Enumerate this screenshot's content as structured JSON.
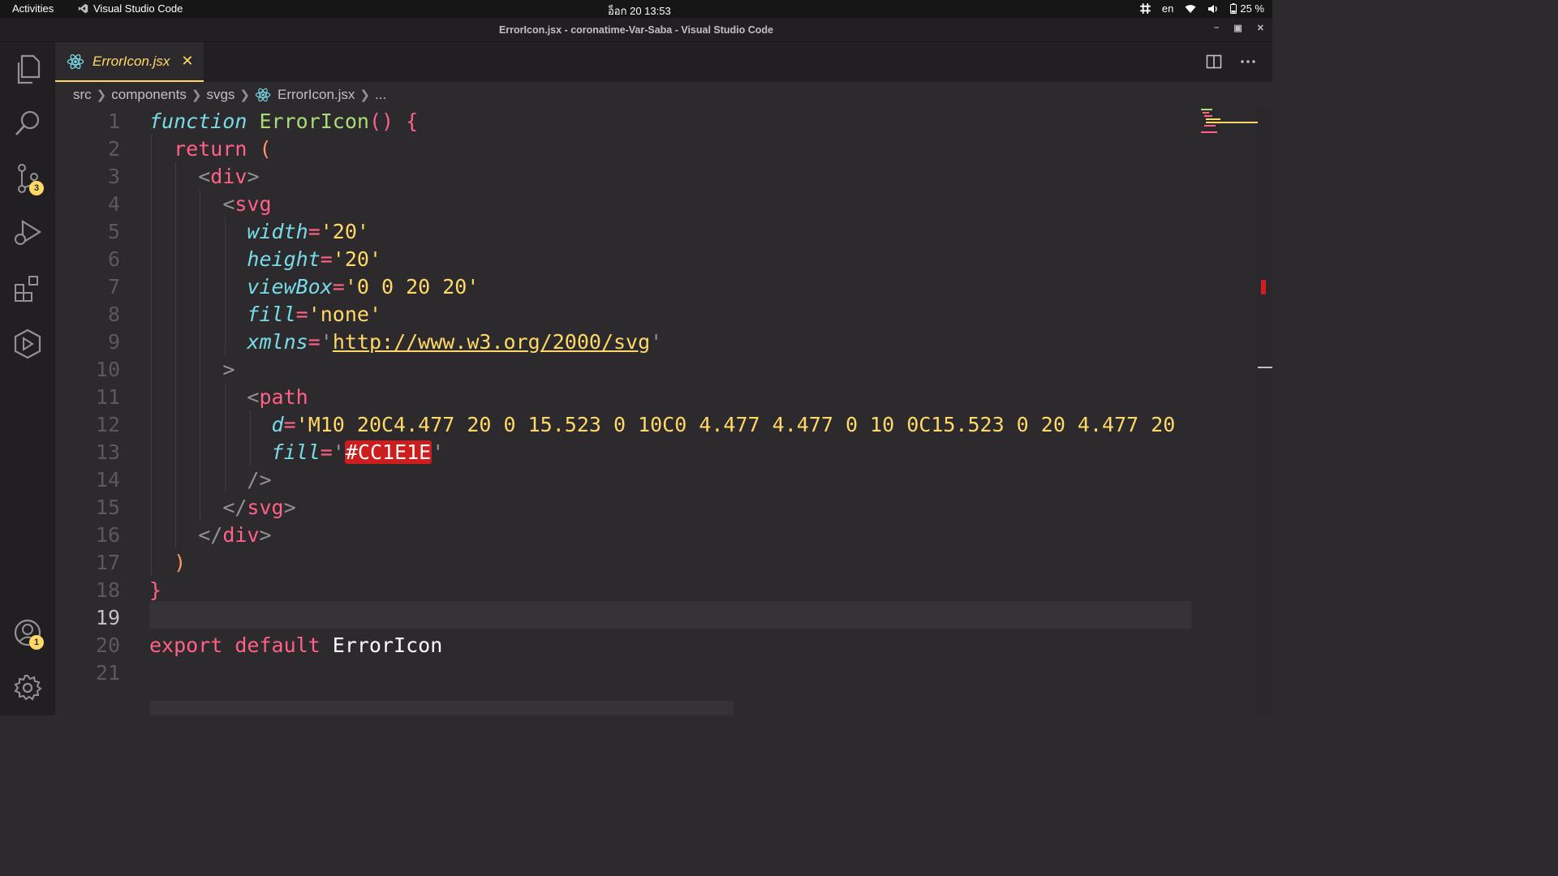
{
  "topbar": {
    "activities": "Activities",
    "app_name": "Visual Studio Code",
    "clock": "อ็อก 20  13:53",
    "language": "en",
    "battery": "25 %"
  },
  "window": {
    "title": "ErrorIcon.jsx - coronatime-Var-Saba - Visual Studio Code"
  },
  "activity_bar": {
    "source_control_badge": "3",
    "accounts_badge": "1"
  },
  "tab": {
    "label": "ErrorIcon.jsx"
  },
  "breadcrumb": {
    "items": [
      "src",
      "components",
      "svgs",
      "ErrorIcon.jsx",
      "..."
    ]
  },
  "editor": {
    "line_numbers": [
      "1",
      "2",
      "3",
      "4",
      "5",
      "6",
      "7",
      "8",
      "9",
      "10",
      "11",
      "12",
      "13",
      "14",
      "15",
      "16",
      "17",
      "18",
      "19",
      "20",
      "21"
    ],
    "active_line": "19",
    "tokens": {
      "l1_kw": "function",
      "l1_fn": "ErrorIcon",
      "l1_paren": "()",
      "l1_brace": "{",
      "l2_kw": "return",
      "l2_paren": "(",
      "l3_open": "<",
      "l3_tag": "div",
      "l3_close": ">",
      "l4_open": "<",
      "l4_tag": "svg",
      "l5_attr": "width",
      "l5_eq": "=",
      "l5_val": "'20'",
      "l6_attr": "height",
      "l6_eq": "=",
      "l6_val": "'20'",
      "l7_attr": "viewBox",
      "l7_eq": "=",
      "l7_val": "'0 0 20 20'",
      "l8_attr": "fill",
      "l8_eq": "=",
      "l8_val": "'none'",
      "l9_attr": "xmlns",
      "l9_eq": "=",
      "l9_q1": "'",
      "l9_url": "http://www.w3.org/2000/svg",
      "l9_q2": "'",
      "l10_close": ">",
      "l11_open": "<",
      "l11_tag": "path",
      "l12_attr": "d",
      "l12_eq": "=",
      "l12_val": "'M10 20C4.477 20 0 15.523 0 10C0 4.477 4.477 0 10 0C15.523 0 20 4.477 20",
      "l13_attr": "fill",
      "l13_eq": "=",
      "l13_q1": "'",
      "l13_hex": "#CC1E1E",
      "l13_q2": "'",
      "l14_selfclose": "/>",
      "l15_open": "</",
      "l15_tag": "svg",
      "l15_close": ">",
      "l16_open": "</",
      "l16_tag": "div",
      "l16_close": ">",
      "l17_paren": ")",
      "l18_brace": "}",
      "l20_kw": "export default",
      "l20_name": "ErrorIcon"
    }
  },
  "colors": {
    "accent": "#ffd866",
    "error_highlight": "#CC1E1E",
    "background": "#2d2a2e"
  }
}
